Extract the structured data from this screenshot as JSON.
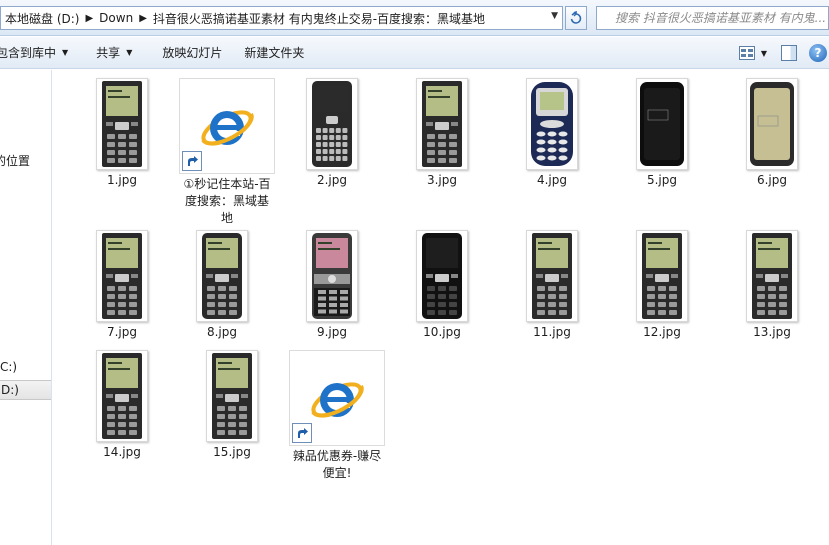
{
  "address_bar": {
    "crumbs": [
      "本地磁盘 (D:)",
      "Down",
      "抖音很火恶搞诺基亚素材 有内鬼终止交易-百度搜索：黑域基地"
    ],
    "search_placeholder": "搜索 抖音很火恶搞诺基亚素材 有内鬼..."
  },
  "toolbar": {
    "include_library": "包含到库中",
    "share": "共享",
    "slideshow": "放映幻灯片",
    "new_folder": "新建文件夹"
  },
  "nav": {
    "recent": "的位置",
    "drive_c": "C:)",
    "drive_d": "D:)"
  },
  "files": [
    {
      "name": "1.jpg",
      "kind": "phone",
      "model": "candybar",
      "screen": "#b5bd86"
    },
    {
      "name": "①秒记住本站-百度搜索：黑域基地",
      "kind": "shortcut"
    },
    {
      "name": "2.jpg",
      "kind": "phone",
      "model": "qwerty",
      "screen": "#2b2b2b"
    },
    {
      "name": "3.jpg",
      "kind": "phone",
      "model": "candybar",
      "screen": "#b5bd86"
    },
    {
      "name": "4.jpg",
      "kind": "phone",
      "model": "3310",
      "screen": "#b6c48a"
    },
    {
      "name": "5.jpg",
      "kind": "phone",
      "model": "smart-dark",
      "screen": "#1a1a1a"
    },
    {
      "name": "6.jpg",
      "kind": "phone",
      "model": "smart-light",
      "screen": "#c5bf93"
    },
    {
      "name": "7.jpg",
      "kind": "phone",
      "model": "candybar",
      "screen": "#b5bd86"
    },
    {
      "name": "8.jpg",
      "kind": "phone",
      "model": "feature-dark",
      "screen": "#b5bd86"
    },
    {
      "name": "9.jpg",
      "kind": "phone",
      "model": "slider",
      "screen": "#c9889c"
    },
    {
      "name": "10.jpg",
      "kind": "phone",
      "model": "feature-black",
      "screen": "#1e1e1e"
    },
    {
      "name": "11.jpg",
      "kind": "phone",
      "model": "candybar",
      "screen": "#b5bd86"
    },
    {
      "name": "12.jpg",
      "kind": "phone",
      "model": "candybar",
      "screen": "#b5bd86"
    },
    {
      "name": "13.jpg",
      "kind": "phone",
      "model": "candybar",
      "screen": "#b5bd86"
    },
    {
      "name": "14.jpg",
      "kind": "phone",
      "model": "candybar",
      "screen": "#b5bd86"
    },
    {
      "name": "15.jpg",
      "kind": "phone",
      "model": "candybar",
      "screen": "#b5bd86"
    },
    {
      "name": "辣品优惠券-赚尽便宜!",
      "kind": "shortcut"
    }
  ],
  "colors": {
    "nokia_body": "#2a2a2a",
    "lcd_green": "#b5bd86",
    "ie_blue": "#1e73c8",
    "ie_ring": "#f2b01e"
  }
}
